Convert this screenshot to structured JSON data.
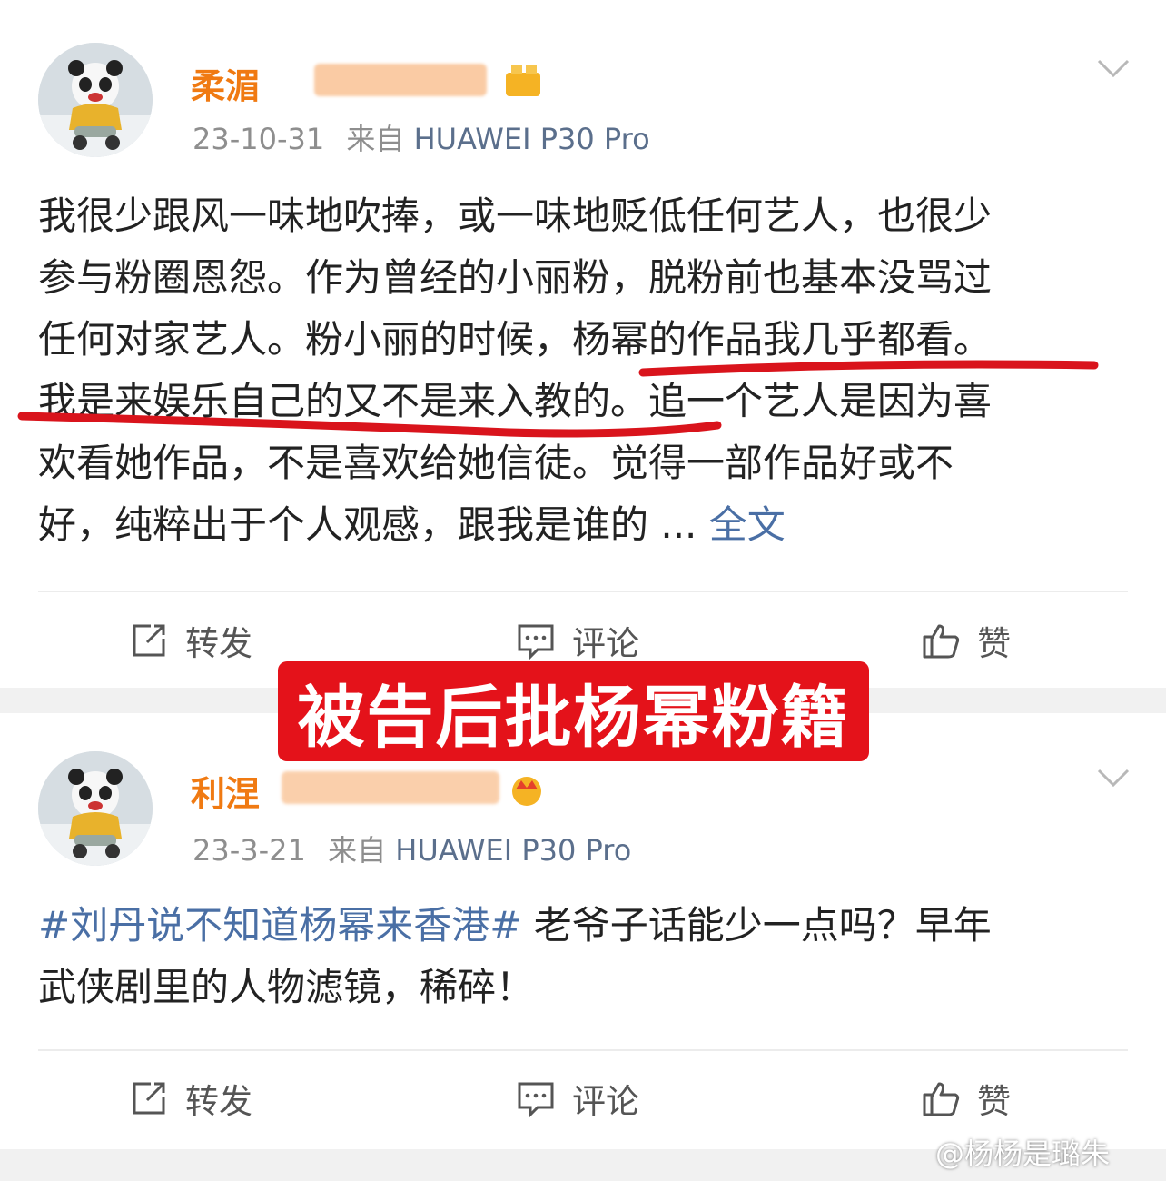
{
  "posts": [
    {
      "username_visible": "柔湄",
      "date": "23-10-31",
      "source_prefix": "来自",
      "device": "HUAWEI P30 Pro",
      "lines": [
        "我很少跟风一味地吹捧，或一味地贬低任何艺人，也很少",
        "参与粉圈恩怨。作为曾经的小丽粉，脱粉前也基本没骂过",
        "任何对家艺人。粉小丽的时候，杨幂的作品我几乎都看。",
        "我是来娱乐自己的又不是来入教的。追一个艺人是因为喜",
        "欢看她作品，不是喜欢给她信徒。觉得一部作品好或不",
        "好，纯粹出于个人观感，跟我是谁的 ..."
      ],
      "more_link": "全文",
      "actions": {
        "repost": "转发",
        "comment": "评论",
        "like": "赞"
      }
    },
    {
      "username_visible": "利涅",
      "date": "23-3-21",
      "source_prefix": "来自",
      "device": "HUAWEI P30 Pro",
      "hashtag": "#刘丹说不知道杨幂来香港#",
      "line1_rest": " 老爷子话能少一点吗？早年",
      "line2": "武侠剧里的人物滤镜，稀碎！",
      "actions": {
        "repost": "转发",
        "comment": "评论",
        "like": "赞"
      }
    }
  ],
  "banner": "被告后批杨幂粉籍",
  "watermark": "@杨杨是璐朱",
  "colors": {
    "link": "#4a6fa5",
    "username": "#f07a12",
    "banner": "#e4121a",
    "underline": "#d9141c"
  },
  "icons": {
    "repost": "repost-icon",
    "comment": "comment-icon",
    "like": "thumbs-up-icon",
    "more": "chevron-down-icon",
    "badge": "crown-icon"
  }
}
